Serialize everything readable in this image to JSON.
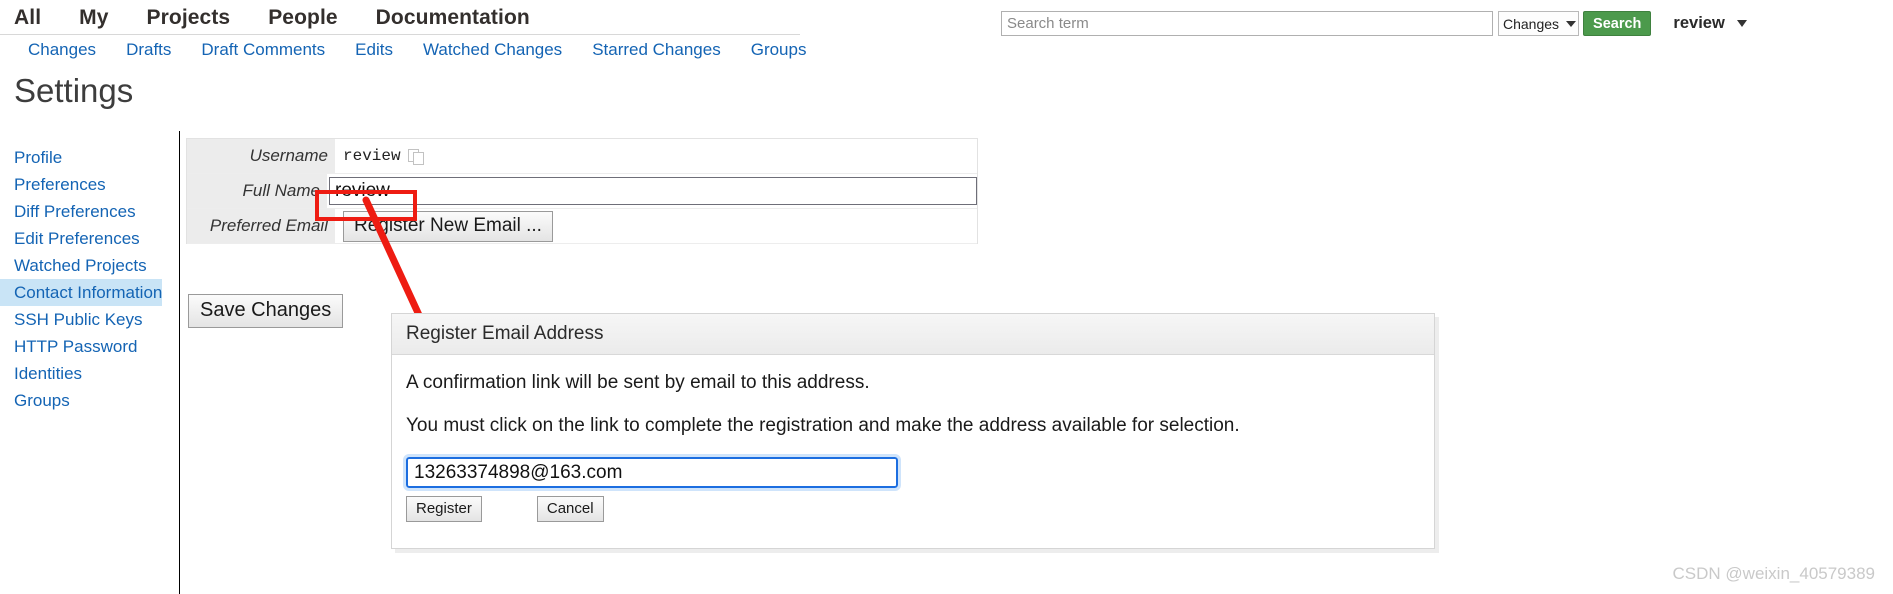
{
  "header": {
    "main_nav": [
      {
        "label": "All"
      },
      {
        "label": "My"
      },
      {
        "label": "Projects"
      },
      {
        "label": "People"
      },
      {
        "label": "Documentation"
      }
    ],
    "search": {
      "placeholder": "Search term",
      "value": "",
      "type_selected": "Changes",
      "button_label": "Search",
      "chevron_icon": "chevron-down-icon"
    },
    "account": {
      "name": "review",
      "chevron_icon": "chevron-down-icon"
    }
  },
  "sub_nav": [
    {
      "label": "Changes"
    },
    {
      "label": "Drafts"
    },
    {
      "label": "Draft Comments"
    },
    {
      "label": "Edits"
    },
    {
      "label": "Watched Changes"
    },
    {
      "label": "Starred Changes"
    },
    {
      "label": "Groups"
    }
  ],
  "page": {
    "title": "Settings"
  },
  "sidebar": {
    "items": [
      {
        "label": "Profile",
        "selected": false
      },
      {
        "label": "Preferences",
        "selected": false
      },
      {
        "label": "Diff Preferences",
        "selected": false
      },
      {
        "label": "Edit Preferences",
        "selected": false
      },
      {
        "label": "Watched Projects",
        "selected": false
      },
      {
        "label": "Contact Information",
        "selected": true
      },
      {
        "label": "SSH Public Keys",
        "selected": false
      },
      {
        "label": "HTTP Password",
        "selected": false
      },
      {
        "label": "Identities",
        "selected": false
      },
      {
        "label": "Groups",
        "selected": false
      }
    ]
  },
  "contact_form": {
    "username": {
      "label": "Username",
      "value": "review",
      "copy_icon": "copy-icon"
    },
    "full_name": {
      "label": "Full Name",
      "value": "review",
      "placeholder": ""
    },
    "preferred_email": {
      "label": "Preferred Email",
      "register_button_label": "Register New Email ..."
    },
    "save_button_label": "Save Changes"
  },
  "dialog": {
    "title": "Register Email Address",
    "line1": "A confirmation link will be sent by email to this address.",
    "line2": "You must click on the link to complete the registration and make the address available for selection.",
    "email_value": "13263374898@163.com",
    "email_placeholder": "",
    "register_label": "Register",
    "cancel_label": "Cancel"
  },
  "annotation": {
    "color": "#ee1c12"
  },
  "watermark": {
    "text": "CSDN @weixin_40579389"
  }
}
